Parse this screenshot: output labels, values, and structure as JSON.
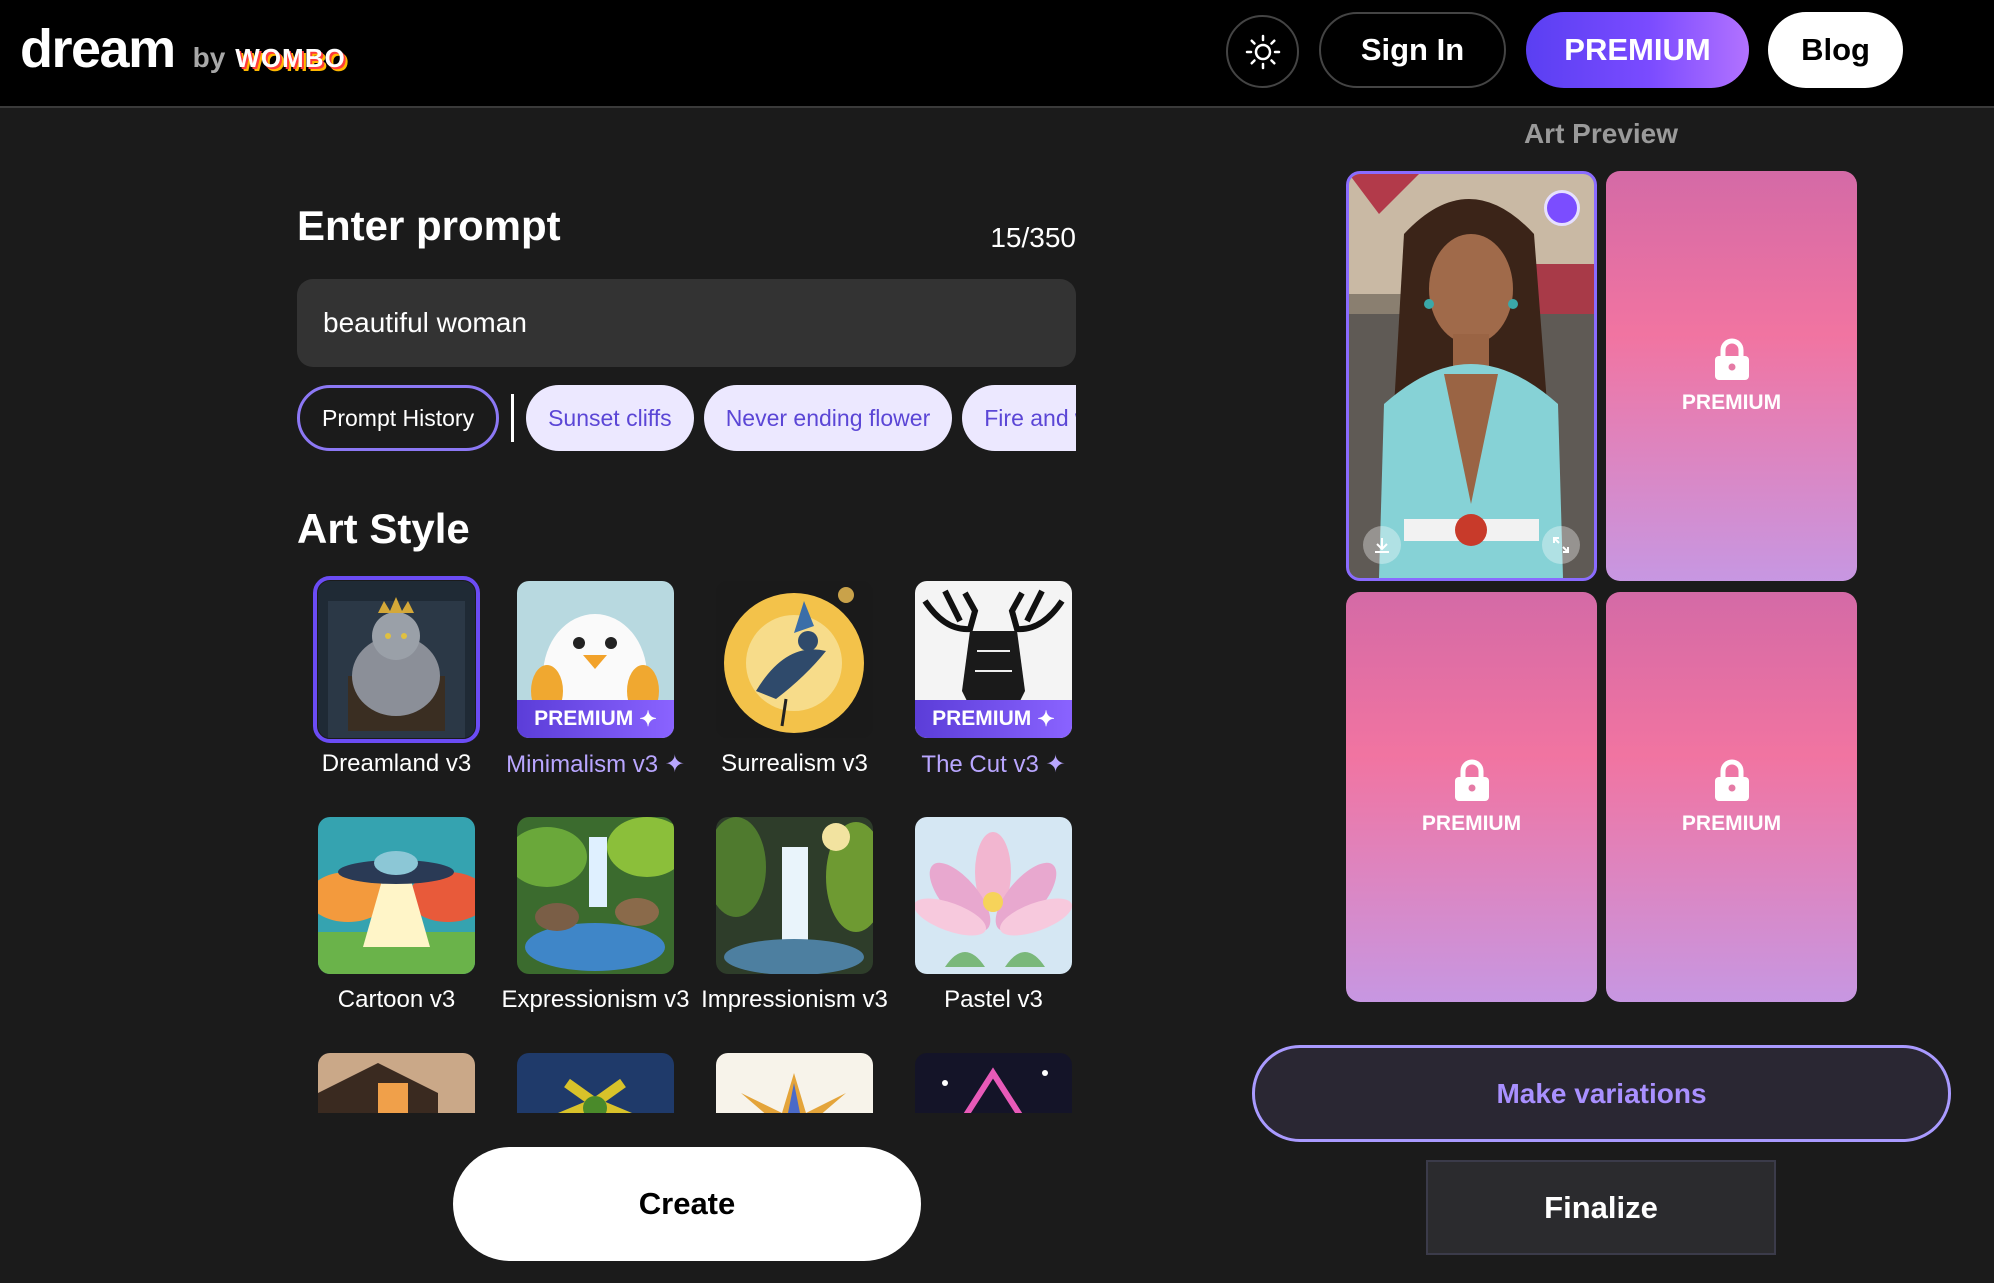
{
  "header": {
    "logo_dream": "dream",
    "logo_by": "by",
    "logo_wombo": "WOMBO",
    "sign_in": "Sign In",
    "premium": "PREMIUM",
    "blog": "Blog"
  },
  "prompt": {
    "title": "Enter prompt",
    "count": "15/350",
    "value": "beautiful woman"
  },
  "chips": {
    "history": "Prompt History",
    "suggestions": [
      "Sunset cliffs",
      "Never ending flower",
      "Fire and water"
    ]
  },
  "art_style": {
    "title": "Art Style",
    "selected": "Dreamland v3",
    "premium_badge": "PREMIUM",
    "items": [
      {
        "label": "Dreamland v3",
        "premium": false
      },
      {
        "label": "Minimalism v3",
        "premium": true
      },
      {
        "label": "Surrealism v3",
        "premium": false
      },
      {
        "label": "The Cut v3",
        "premium": true
      },
      {
        "label": "Cartoon v3",
        "premium": false
      },
      {
        "label": "Expressionism v3",
        "premium": false
      },
      {
        "label": "Impressionism v3",
        "premium": false
      },
      {
        "label": "Pastel v3",
        "premium": false
      }
    ]
  },
  "create_button": "Create",
  "preview": {
    "title": "Art Preview",
    "locked_label": "PREMIUM"
  },
  "actions": {
    "make_variations": "Make variations",
    "finalize": "Finalize"
  },
  "colors": {
    "accent": "#6b4cf5",
    "chip_bg": "#ece8ff",
    "chip_text": "#5b46d6",
    "background": "#1b1b1b"
  }
}
